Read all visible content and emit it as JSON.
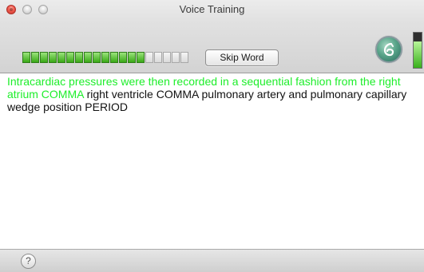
{
  "window": {
    "title": "Voice Training"
  },
  "toolbar": {
    "audio_level": {
      "filled_segments": 14,
      "total_segments": 19
    },
    "skip_label": "Skip Word",
    "volume_level": 0.75,
    "icons": {
      "app": "dragon-icon"
    }
  },
  "text": {
    "spoken": "Intracardiac pressures were then recorded in a sequential fashion from the right atrium COMMA",
    "pending": " right ventricle COMMA pulmonary artery and pulmonary capillary wedge position PERIOD"
  },
  "footer": {
    "help_label": "?"
  },
  "colors": {
    "spoken": "#1dee2a",
    "pending": "#111111"
  }
}
